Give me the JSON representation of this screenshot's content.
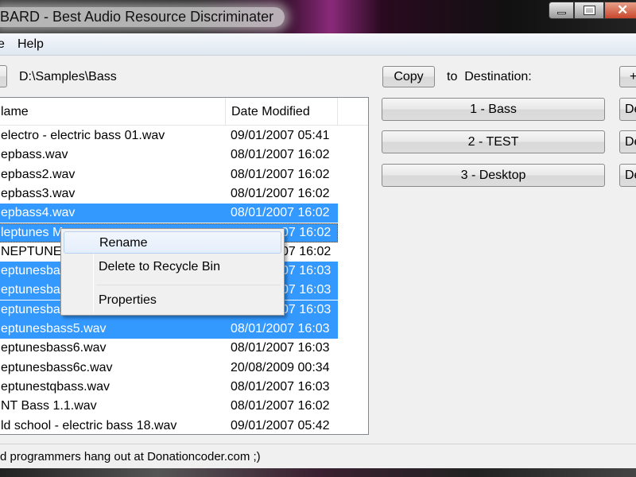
{
  "window": {
    "title": "BARD - Best Audio Resource Discriminater"
  },
  "menu": [
    "e",
    "Help"
  ],
  "path": {
    "value": "D:\\Samples\\Bass"
  },
  "toolbar": {
    "copy_label": "Copy",
    "to_destination_label": "to  Destination:",
    "add_label": "+"
  },
  "destinations": [
    {
      "label": "1 - Bass",
      "delete_label": "De"
    },
    {
      "label": "2 - TEST",
      "delete_label": "De"
    },
    {
      "label": "3 - Desktop",
      "delete_label": "De"
    }
  ],
  "list": {
    "columns": [
      "lame",
      "Date Modified"
    ],
    "rows": [
      {
        "name": "electro - electric bass 01.wav",
        "date": "09/01/2007 05:41",
        "selected": false
      },
      {
        "name": "epbass.wav",
        "date": "08/01/2007 16:02",
        "selected": false
      },
      {
        "name": "epbass2.wav",
        "date": "08/01/2007 16:02",
        "selected": false
      },
      {
        "name": "epbass3.wav",
        "date": "08/01/2007 16:02",
        "selected": false
      },
      {
        "name": "epbass4.wav",
        "date": "08/01/2007 16:02",
        "selected": true
      },
      {
        "name": "leptunes M",
        "date": "07 16:02",
        "selected": true,
        "focused": true
      },
      {
        "name": "NEPTUNES",
        "date": "07 16:02",
        "selected": false
      },
      {
        "name": "eptunesbas",
        "date": "07 16:03",
        "selected": true
      },
      {
        "name": "eptunesbas",
        "date": "07 16:03",
        "selected": true
      },
      {
        "name": "eptunesbas",
        "date": "07 16:03",
        "selected": true
      },
      {
        "name": "eptunesbass5.wav",
        "date": "08/01/2007 16:03",
        "selected": true
      },
      {
        "name": "eptunesbass6.wav",
        "date": "08/01/2007 16:03",
        "selected": false
      },
      {
        "name": "eptunesbass6c.wav",
        "date": "20/08/2009 00:34",
        "selected": false
      },
      {
        "name": "eptunestqbass.wav",
        "date": "08/01/2007 16:03",
        "selected": false
      },
      {
        "name": "NT Bass 1.1.wav",
        "date": "08/01/2007 16:02",
        "selected": false
      },
      {
        "name": "ld school - electric bass 18.wav",
        "date": "09/01/2007 05:42",
        "selected": false
      }
    ]
  },
  "context_menu": {
    "items": [
      "Rename",
      "Delete to Recycle Bin",
      "Properties"
    ]
  },
  "status": {
    "text": "d programmers hang out at Donationcoder.com ;)"
  },
  "colors": {
    "selection": "#3399ff",
    "close_button": "#c9462c"
  }
}
